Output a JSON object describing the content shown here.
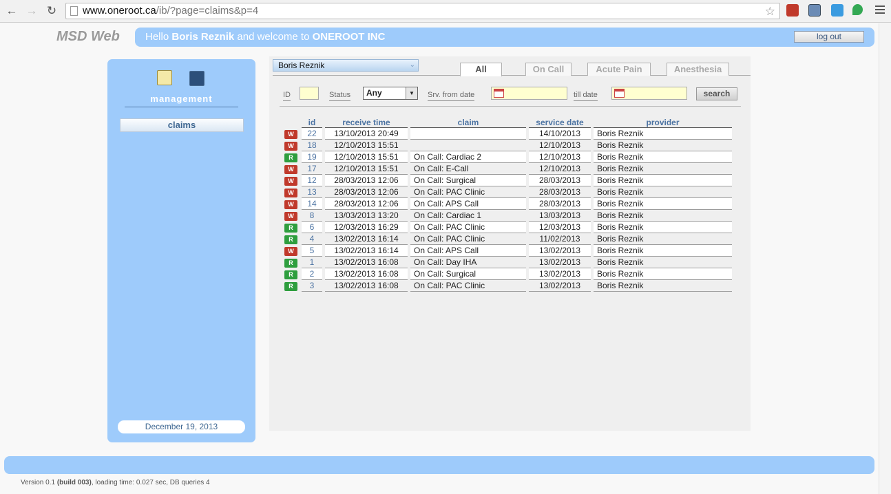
{
  "browser": {
    "url_host": "www.oneroot.ca",
    "url_path": "/ib/?page=claims&p=4"
  },
  "header": {
    "brand": "MSD Web",
    "welcome_prefix": "Hello ",
    "user_name": "Boris Reznik",
    "welcome_middle": " and welcome to ",
    "org_name": "ONEROOT INC",
    "logout_label": "log out"
  },
  "sidebar": {
    "section_label": "management",
    "menu_item": "claims",
    "date": "December 19, 2013"
  },
  "main": {
    "selected_user": "Boris Reznik",
    "tabs": [
      "All",
      "On Call",
      "Acute Pain",
      "Anesthesia"
    ],
    "active_tab": "All",
    "filters": {
      "id_label": "ID",
      "status_label": "Status",
      "status_value": "Any",
      "from_label": "Srv. from date",
      "till_label": "till date",
      "search_label": "search"
    },
    "table": {
      "headers": [
        "id",
        "receive time",
        "claim",
        "service date",
        "provider"
      ],
      "rows": [
        {
          "badge": "W",
          "id": "22",
          "receive": "13/10/2013 20:49",
          "claim": "",
          "service": "14/10/2013",
          "provider": "Boris Reznik"
        },
        {
          "badge": "W",
          "id": "18",
          "receive": "12/10/2013 15:51",
          "claim": "",
          "service": "12/10/2013",
          "provider": "Boris Reznik"
        },
        {
          "badge": "R",
          "id": "19",
          "receive": "12/10/2013 15:51",
          "claim": "On Call: Cardiac 2",
          "service": "12/10/2013",
          "provider": "Boris Reznik"
        },
        {
          "badge": "W",
          "id": "17",
          "receive": "12/10/2013 15:51",
          "claim": "On Call: E-Call",
          "service": "12/10/2013",
          "provider": "Boris Reznik"
        },
        {
          "badge": "W",
          "id": "12",
          "receive": "28/03/2013 12:06",
          "claim": "On Call: Surgical",
          "service": "28/03/2013",
          "provider": "Boris Reznik"
        },
        {
          "badge": "W",
          "id": "13",
          "receive": "28/03/2013 12:06",
          "claim": "On Call: PAC Clinic",
          "service": "28/03/2013",
          "provider": "Boris Reznik"
        },
        {
          "badge": "W",
          "id": "14",
          "receive": "28/03/2013 12:06",
          "claim": "On Call: APS Call",
          "service": "28/03/2013",
          "provider": "Boris Reznik"
        },
        {
          "badge": "W",
          "id": "8",
          "receive": "13/03/2013 13:20",
          "claim": "On Call: Cardiac 1",
          "service": "13/03/2013",
          "provider": "Boris Reznik"
        },
        {
          "badge": "R",
          "id": "6",
          "receive": "12/03/2013 16:29",
          "claim": "On Call: PAC Clinic",
          "service": "12/03/2013",
          "provider": "Boris Reznik"
        },
        {
          "badge": "R",
          "id": "4",
          "receive": "13/02/2013 16:14",
          "claim": "On Call: PAC Clinic",
          "service": "11/02/2013",
          "provider": "Boris Reznik"
        },
        {
          "badge": "W",
          "id": "5",
          "receive": "13/02/2013 16:14",
          "claim": "On Call: APS Call",
          "service": "13/02/2013",
          "provider": "Boris Reznik"
        },
        {
          "badge": "R",
          "id": "1",
          "receive": "13/02/2013 16:08",
          "claim": "On Call: Day IHA",
          "service": "13/02/2013",
          "provider": "Boris Reznik"
        },
        {
          "badge": "R",
          "id": "2",
          "receive": "13/02/2013 16:08",
          "claim": "On Call: Surgical",
          "service": "13/02/2013",
          "provider": "Boris Reznik"
        },
        {
          "badge": "R",
          "id": "3",
          "receive": "13/02/2013 16:08",
          "claim": "On Call: PAC Clinic",
          "service": "13/02/2013",
          "provider": "Boris Reznik"
        }
      ]
    }
  },
  "footer": {
    "version_prefix": "Version 0.1 ",
    "build": "(build 003)",
    "stats": ", loading time: 0.027 sec, DB queries 4"
  },
  "colors": {
    "panel_blue": "#9ecbfb",
    "link_blue": "#4d74a3",
    "badge_w": "#c0392b",
    "badge_r": "#2e9e3e",
    "input_yellow": "#ffffd0"
  }
}
